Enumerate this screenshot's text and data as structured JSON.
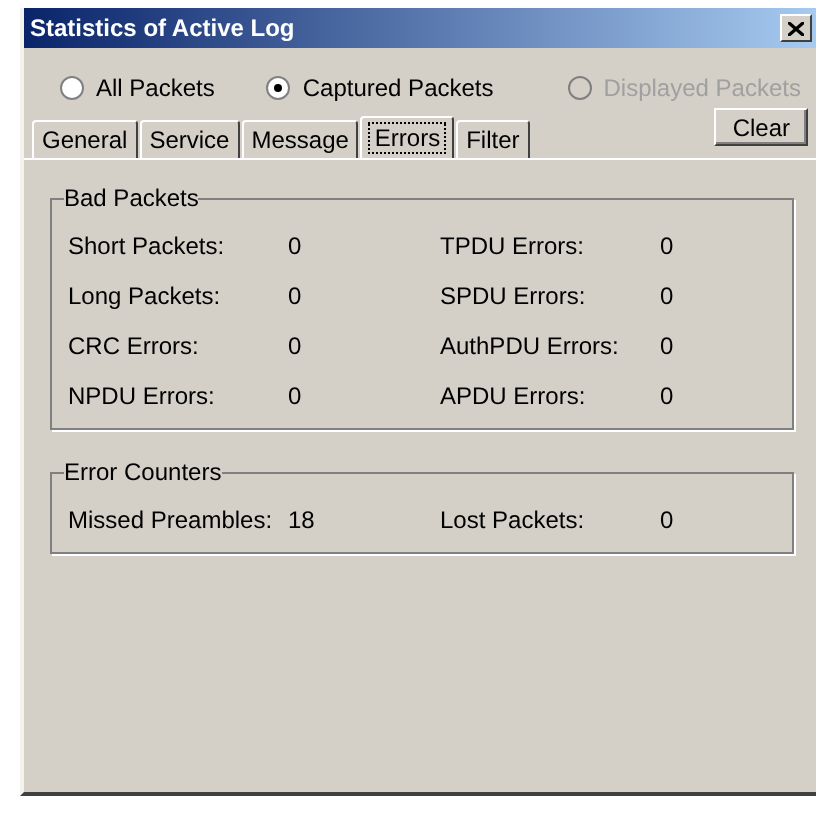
{
  "window": {
    "title": "Statistics of Active Log"
  },
  "packet_filter": [
    {
      "label": "All Packets",
      "selected": false,
      "disabled": false
    },
    {
      "label": "Captured Packets",
      "selected": true,
      "disabled": false
    },
    {
      "label": "Displayed Packets",
      "selected": false,
      "disabled": true
    }
  ],
  "tabs": [
    {
      "label": "General",
      "selected": false
    },
    {
      "label": "Service",
      "selected": false
    },
    {
      "label": "Message",
      "selected": false
    },
    {
      "label": "Errors",
      "selected": true
    },
    {
      "label": "Filter",
      "selected": false
    }
  ],
  "clear_button": "Clear",
  "groups": [
    {
      "title": "Bad Packets",
      "rows": [
        [
          {
            "label": "Short Packets:",
            "value": "0"
          },
          {
            "label": "TPDU Errors:",
            "value": "0"
          }
        ],
        [
          {
            "label": "Long Packets:",
            "value": "0"
          },
          {
            "label": "SPDU Errors:",
            "value": "0"
          }
        ],
        [
          {
            "label": "CRC Errors:",
            "value": "0"
          },
          {
            "label": "AuthPDU Errors:",
            "value": "0"
          }
        ],
        [
          {
            "label": "NPDU Errors:",
            "value": "0"
          },
          {
            "label": "APDU Errors:",
            "value": "0"
          }
        ]
      ]
    },
    {
      "title": "Error Counters",
      "rows": [
        [
          {
            "label": "Missed Preambles:",
            "value": "18"
          },
          {
            "label": "Lost Packets:",
            "value": "0"
          }
        ]
      ]
    }
  ]
}
